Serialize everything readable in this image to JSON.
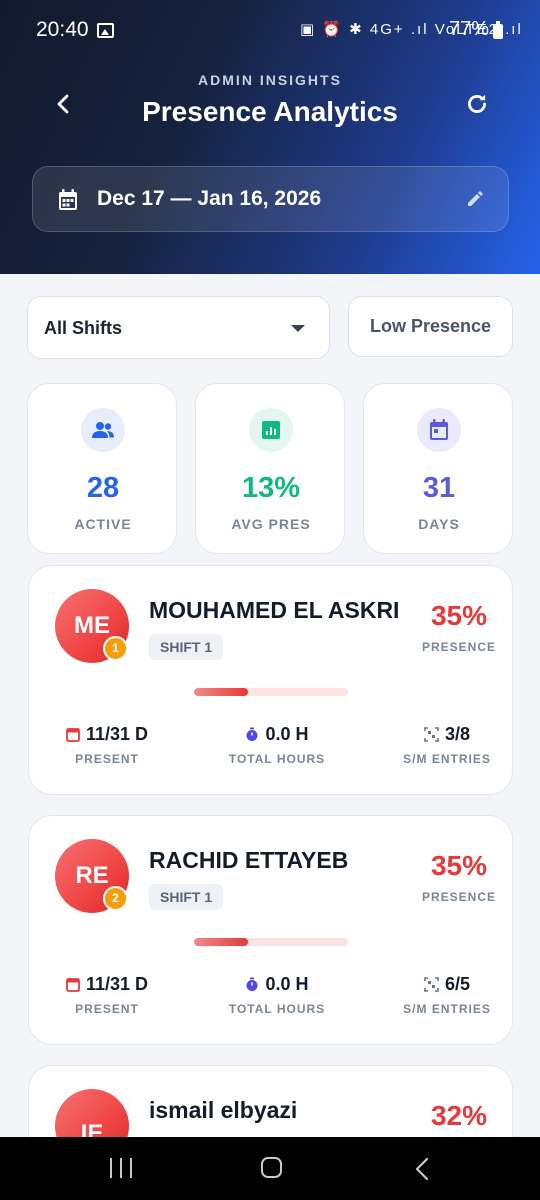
{
  "status_bar": {
    "time": "20:40",
    "icons": "▣ ⏰ ✱ 4G+ .ıl VoLTE2 .ıl",
    "battery": "77%"
  },
  "header": {
    "eyebrow": "ADMIN INSIGHTS",
    "title": "Presence Analytics",
    "date_range": "Dec 17 — Jan 16, 2026"
  },
  "filters": {
    "shift_select": "All Shifts",
    "low_presence_button": "Low Presence"
  },
  "stats": [
    {
      "value": "28",
      "label": "ACTIVE",
      "color": "#2563eb",
      "icon": "users-icon",
      "bg": "#e7edfb"
    },
    {
      "value": "13%",
      "label": "AVG PRES",
      "color": "#10b981",
      "icon": "analytics-icon",
      "bg": "#e3f6ef"
    },
    {
      "value": "31",
      "label": "DAYS",
      "color": "#5b5bd6",
      "icon": "calendar-icon",
      "bg": "#ebeafb"
    }
  ],
  "employees": [
    {
      "initials": "ME",
      "rank": "1",
      "name": "MOUHAMED EL ASKRI",
      "shift": "SHIFT 1",
      "presence": "35%",
      "presence_label": "PRESENCE",
      "presence_fraction": 0.35,
      "present": "11/31 D",
      "present_label": "PRESENT",
      "hours": "0.0 H",
      "hours_label": "TOTAL HOURS",
      "entries": "3/8",
      "entries_label": "S/M ENTRIES"
    },
    {
      "initials": "RE",
      "rank": "2",
      "name": "RACHID ETTAYEB",
      "shift": "SHIFT 1",
      "presence": "35%",
      "presence_label": "PRESENCE",
      "presence_fraction": 0.35,
      "present": "11/31 D",
      "present_label": "PRESENT",
      "hours": "0.0 H",
      "hours_label": "TOTAL HOURS",
      "entries": "6/5",
      "entries_label": "S/M ENTRIES"
    },
    {
      "initials": "IE",
      "name": "ismail elbyazi",
      "presence": "32%",
      "presence_fraction": 0.32
    }
  ]
}
